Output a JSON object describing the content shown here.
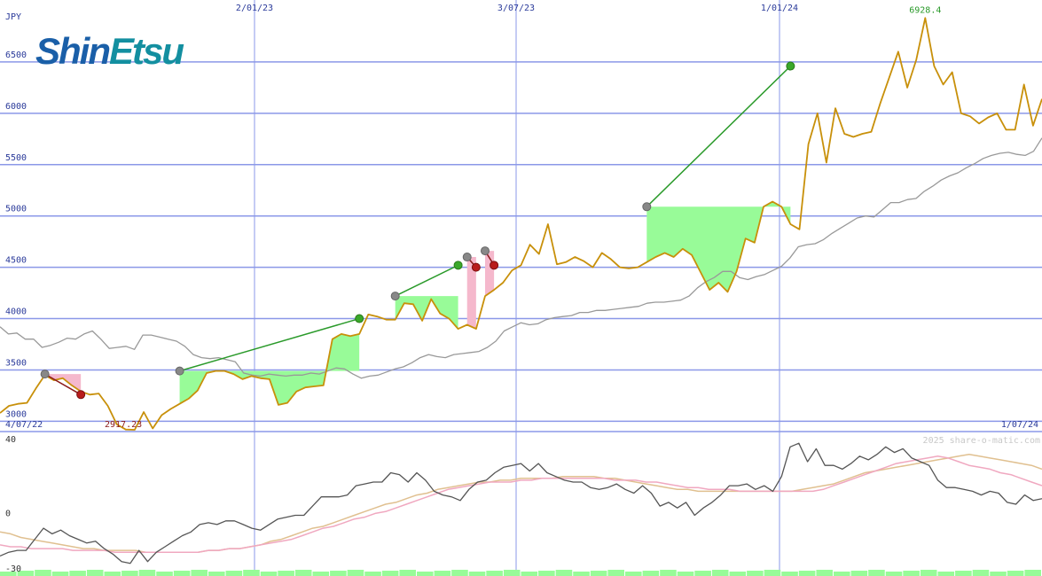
{
  "logo": {
    "left": "Shin",
    "right": "Etsu"
  },
  "watermark": "2025 share-o-matic.com",
  "colors": {
    "price": "#c8900a",
    "benchmark": "#999999",
    "gain_fill": "#98fb98",
    "loss_fill": "#f5b8cc",
    "trade_line_gain": "#2a9a2a",
    "trade_line_loss": "#8b1a1a",
    "grid": "#8b98e8",
    "axis_text": "#2a3a9a",
    "osc_main": "#555555",
    "osc_pink": "#f0a8c0",
    "osc_tan": "#e0c090",
    "volume": "#98fb98"
  },
  "chart_data": [
    {
      "type": "line",
      "title": "",
      "ylabel": "JPY",
      "ylim": [
        2900,
        7000
      ],
      "yticks": [
        3000,
        3500,
        4000,
        4500,
        5000,
        5500,
        6000,
        6500
      ],
      "x_labels": [
        "2/01/23",
        "3/07/23",
        "1/01/24"
      ],
      "start_label": "4/07/22",
      "end_label": "1/07/24",
      "max_label": "6928.4",
      "min_label": "2917.23",
      "grid": true,
      "series": [
        {
          "values": [
            3080,
            3150,
            3170,
            3180,
            3320,
            3450,
            3400,
            3420,
            3350,
            3290,
            3260,
            3270,
            3150,
            2970,
            2920,
            2917,
            3090,
            2930,
            3060,
            3120,
            3170,
            3220,
            3300,
            3470,
            3490,
            3490,
            3460,
            3410,
            3440,
            3420,
            3410,
            3160,
            3180,
            3290,
            3330,
            3340,
            3350,
            3800,
            3850,
            3830,
            3850,
            4040,
            4020,
            3990,
            3990,
            4150,
            4140,
            3980,
            4190,
            4050,
            4000,
            3900,
            3940,
            3900,
            4220,
            4280,
            4350,
            4470,
            4520,
            4720,
            4630,
            4920,
            4530,
            4550,
            4600,
            4560,
            4500,
            4640,
            4580,
            4500,
            4490,
            4500,
            4550,
            4600,
            4640,
            4600,
            4680,
            4620,
            4450,
            4280,
            4350,
            4260,
            4460,
            4780,
            4740,
            5090,
            5140,
            5090,
            4920,
            4870,
            5700,
            6000,
            5520,
            6050,
            5800,
            5770,
            5800,
            5820,
            6100,
            6350,
            6600,
            6250,
            6520,
            6928,
            6460,
            6280,
            6400,
            6000,
            5970,
            5900,
            5960,
            6000,
            5840,
            5840,
            6280,
            5880,
            6140
          ]
        },
        {
          "values": [
            3920,
            3850,
            3860,
            3800,
            3800,
            3720,
            3740,
            3770,
            3810,
            3800,
            3850,
            3880,
            3800,
            3710,
            3720,
            3730,
            3700,
            3840,
            3840,
            3820,
            3800,
            3780,
            3730,
            3650,
            3620,
            3610,
            3620,
            3600,
            3580,
            3470,
            3450,
            3440,
            3460,
            3450,
            3440,
            3450,
            3450,
            3470,
            3460,
            3490,
            3520,
            3510,
            3460,
            3420,
            3440,
            3450,
            3480,
            3510,
            3530,
            3570,
            3620,
            3650,
            3630,
            3620,
            3650,
            3660,
            3670,
            3680,
            3720,
            3780,
            3880,
            3920,
            3960,
            3940,
            3950,
            3990,
            4010,
            4020,
            4030,
            4060,
            4060,
            4080,
            4080,
            4090,
            4100,
            4110,
            4120,
            4150,
            4160,
            4160,
            4170,
            4180,
            4220,
            4300,
            4360,
            4400,
            4460,
            4460,
            4400,
            4380,
            4410,
            4430,
            4470,
            4510,
            4590,
            4700,
            4720,
            4730,
            4770,
            4830,
            4880,
            4930,
            4980,
            5000,
            4990,
            5060,
            5130,
            5130,
            5160,
            5170,
            5240,
            5290,
            5350,
            5390,
            5420,
            5470,
            5510,
            5560,
            5590,
            5610,
            5620,
            5600,
            5590,
            5630,
            5760
          ]
        }
      ],
      "trades": [
        {
          "entry_index": 5,
          "exit_index": 9,
          "entry": 3460,
          "exit": 3260
        },
        {
          "entry_index": 20,
          "exit_index": 40,
          "entry": 3490,
          "exit": 4000
        },
        {
          "entry_index": 44,
          "exit_index": 51,
          "entry": 4220,
          "exit": 4520
        },
        {
          "entry_index": 52,
          "exit_index": 53,
          "entry": 4600,
          "exit": 4500
        },
        {
          "entry_index": 54,
          "exit_index": 55,
          "entry": 4660,
          "exit": 4520
        },
        {
          "entry_index": 72,
          "exit_index": 88,
          "entry": 5090,
          "exit": 6460
        }
      ]
    },
    {
      "type": "line",
      "ylim": [
        -30,
        40
      ],
      "yticks": [
        40,
        0,
        -30
      ],
      "grid": true,
      "series": [
        {
          "values": [
            -23,
            -21,
            -20,
            -20,
            -14,
            -8,
            -11,
            -9,
            -12,
            -14,
            -16,
            -15,
            -19,
            -22,
            -26,
            -27,
            -20,
            -26,
            -21,
            -18,
            -15,
            -12,
            -10,
            -6,
            -5,
            -6,
            -4,
            -4,
            -6,
            -8,
            -9,
            -6,
            -3,
            -2,
            -1,
            -1,
            4,
            9,
            9,
            9,
            10,
            15,
            16,
            17,
            17,
            22,
            21,
            17,
            22,
            18,
            12,
            10,
            9,
            7,
            13,
            17,
            18,
            22,
            25,
            26,
            27,
            23,
            27,
            22,
            20,
            18,
            17,
            17,
            14,
            13,
            14,
            16,
            13,
            11,
            15,
            11,
            4,
            6,
            3,
            6,
            -1,
            3,
            6,
            10,
            15,
            15,
            16,
            13,
            15,
            12,
            20,
            36,
            38,
            28,
            35,
            26,
            26,
            24,
            27,
            31,
            29,
            32,
            36,
            33,
            35,
            30,
            28,
            26,
            18,
            14,
            14,
            13,
            12,
            10,
            12,
            11,
            6,
            5,
            10,
            7,
            8
          ]
        },
        {
          "values": [
            -17,
            -18,
            -18,
            -19,
            -19,
            -19,
            -19,
            -20,
            -20,
            -20,
            -20,
            -21,
            -21,
            -21,
            -21,
            -21,
            -21,
            -21,
            -21,
            -21,
            -20,
            -20,
            -19,
            -19,
            -18,
            -17,
            -16,
            -15,
            -14,
            -12,
            -10,
            -8,
            -7,
            -5,
            -3,
            -2,
            0,
            1,
            3,
            5,
            7,
            9,
            11,
            13,
            14,
            15,
            16,
            17,
            17,
            17,
            18,
            18,
            19,
            19,
            19,
            19,
            19,
            19,
            19,
            18,
            18,
            18,
            17,
            17,
            16,
            15,
            14,
            14,
            13,
            13,
            13,
            12,
            12,
            12,
            12,
            12,
            12,
            12,
            12,
            13,
            15,
            17,
            19,
            21,
            23,
            25,
            27,
            28,
            29,
            30,
            31,
            30,
            28,
            26,
            25,
            24,
            22,
            21,
            19,
            17,
            15
          ]
        },
        {
          "values": [
            -10,
            -11,
            -13,
            -14,
            -15,
            -16,
            -17,
            -18,
            -19,
            -19,
            -20,
            -20,
            -20,
            -20,
            -21,
            -21,
            -21,
            -21,
            -21,
            -21,
            -20,
            -20,
            -19,
            -19,
            -18,
            -17,
            -15,
            -14,
            -12,
            -10,
            -8,
            -7,
            -5,
            -3,
            -1,
            1,
            3,
            5,
            6,
            8,
            10,
            11,
            13,
            14,
            15,
            16,
            17,
            17,
            18,
            18,
            19,
            19,
            19,
            19,
            20,
            20,
            20,
            20,
            19,
            19,
            18,
            17,
            16,
            15,
            14,
            13,
            13,
            12,
            12,
            12,
            12,
            12,
            12,
            12,
            12,
            12,
            12,
            13,
            14,
            15,
            16,
            18,
            20,
            22,
            23,
            24,
            25,
            26,
            27,
            28,
            29,
            30,
            31,
            32,
            31,
            30,
            29,
            28,
            27,
            26,
            24
          ]
        }
      ]
    }
  ]
}
